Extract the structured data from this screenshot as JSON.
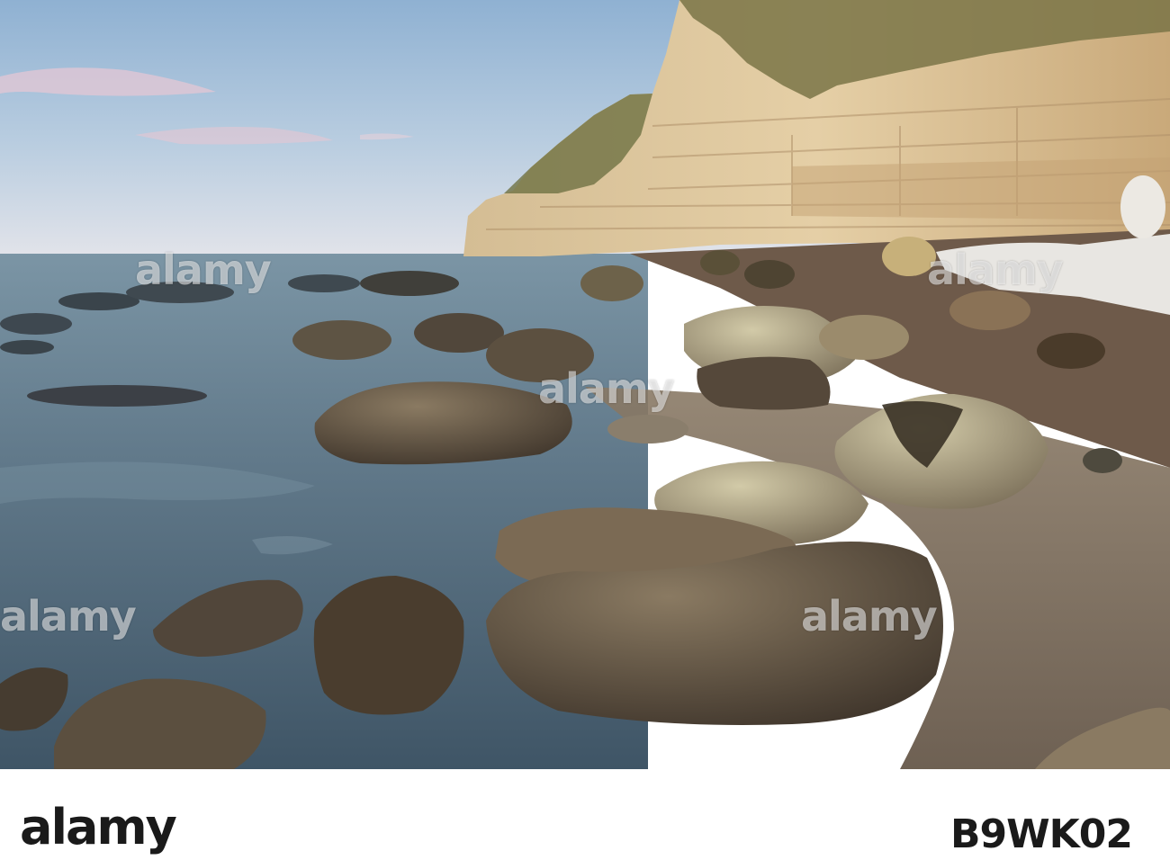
{
  "photo": {
    "description_free": true,
    "colors": {
      "sky_top": "#9dbad6",
      "sky_horizon": "#e6e6ea",
      "sea": "#6f8796",
      "cliff_light": "#e1c9a0",
      "cliff_shadow": "#b89a6d",
      "vegetation": "#6b6a3e",
      "rock": "#6d5f4c",
      "water_pool": "#5f7786"
    }
  },
  "watermarks": [
    "alamy",
    "alamy",
    "alamy",
    "alamy"
  ],
  "footer": {
    "logo": "alamy",
    "image_id": "B9WK02"
  }
}
